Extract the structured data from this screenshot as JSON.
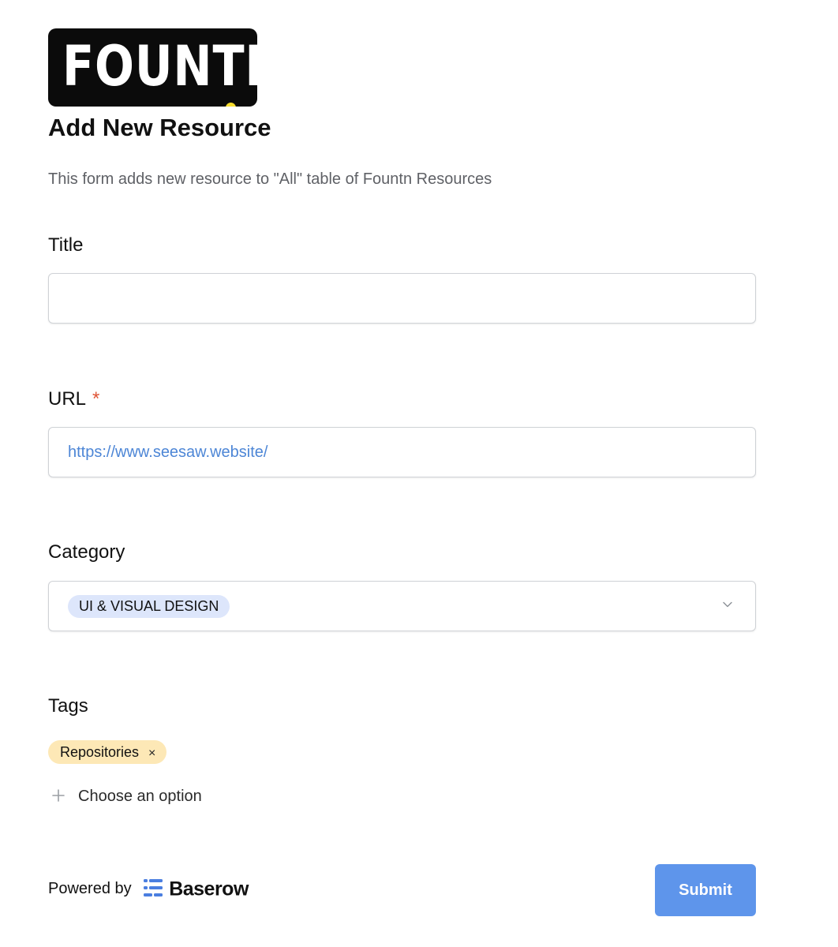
{
  "brand": {
    "logo_text": "FOUNTN",
    "accent_color": "#f6dc2d"
  },
  "form": {
    "title": "Add New Resource",
    "description": "This form adds new resource to \"All\" table of Fountn Resources"
  },
  "fields": {
    "title": {
      "label": "Title",
      "value": "",
      "placeholder": ""
    },
    "url": {
      "label": "URL",
      "required_marker": "*",
      "value": "https://www.seesaw.website/"
    },
    "category": {
      "label": "Category",
      "selected": "UI & VISUAL DESIGN"
    },
    "tags": {
      "label": "Tags",
      "selected": [
        "Repositories"
      ],
      "remove_glyph": "×",
      "add_label": "Choose an option"
    }
  },
  "footer": {
    "powered_by": "Powered by",
    "brand_name": "Baserow",
    "submit_label": "Submit"
  },
  "colors": {
    "submit": "#5e95eb",
    "url_text": "#4d86d6",
    "required": "#df5537",
    "category_pill": "#dde6fb",
    "tag_pill": "#fde8b6",
    "baserow_blue": "#4a7ee0"
  },
  "icons": {
    "category_toggle": "chevron-down-icon",
    "add_tag": "plus-icon",
    "remove_tag": "close-icon",
    "footer_brand": "baserow-logo-icon"
  }
}
